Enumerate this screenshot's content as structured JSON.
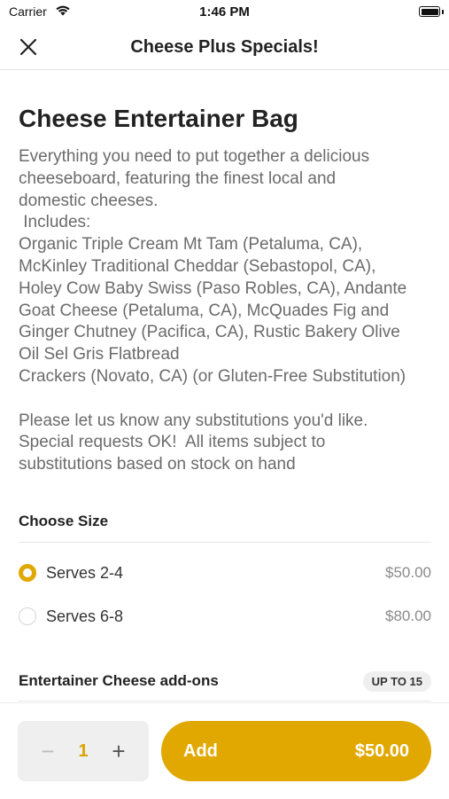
{
  "status_bar": {
    "carrier": "Carrier",
    "time": "1:46 PM"
  },
  "nav": {
    "title": "Cheese Plus Specials!",
    "close_icon": "close-icon"
  },
  "item": {
    "title": "Cheese Entertainer Bag",
    "description": "Everything you need to put together a delicious\ncheeseboard, featuring the finest local and\ndomestic cheeses.\n Includes:\nOrganic Triple Cream Mt Tam (Petaluma, CA),\nMcKinley Traditional Cheddar (Sebastopol, CA),\nHoley Cow Baby Swiss (Paso Robles, CA), Andante\nGoat Cheese (Petaluma, CA), McQuades Fig and\nGinger Chutney (Pacifica, CA), Rustic Bakery Olive\nOil Sel Gris Flatbread\nCrackers (Novato, CA) (or Gluten-Free Substitution)\n\nPlease let us know any substitutions you'd like.\nSpecial requests OK!  All items subject to\nsubstitutions based on stock on hand"
  },
  "size_section": {
    "title": "Choose Size",
    "options": [
      {
        "label": "Serves 2-4",
        "price": "$50.00",
        "selected": true
      },
      {
        "label": "Serves 6-8",
        "price": "$80.00",
        "selected": false
      }
    ]
  },
  "addons_section": {
    "title": "Entertainer Cheese add-ons",
    "limit": "UP TO 15"
  },
  "bottom_bar": {
    "minus": "−",
    "quantity": "1",
    "plus": "+",
    "add_label": "Add",
    "add_price": "$50.00"
  },
  "colors": {
    "accent": "#e0a800"
  }
}
